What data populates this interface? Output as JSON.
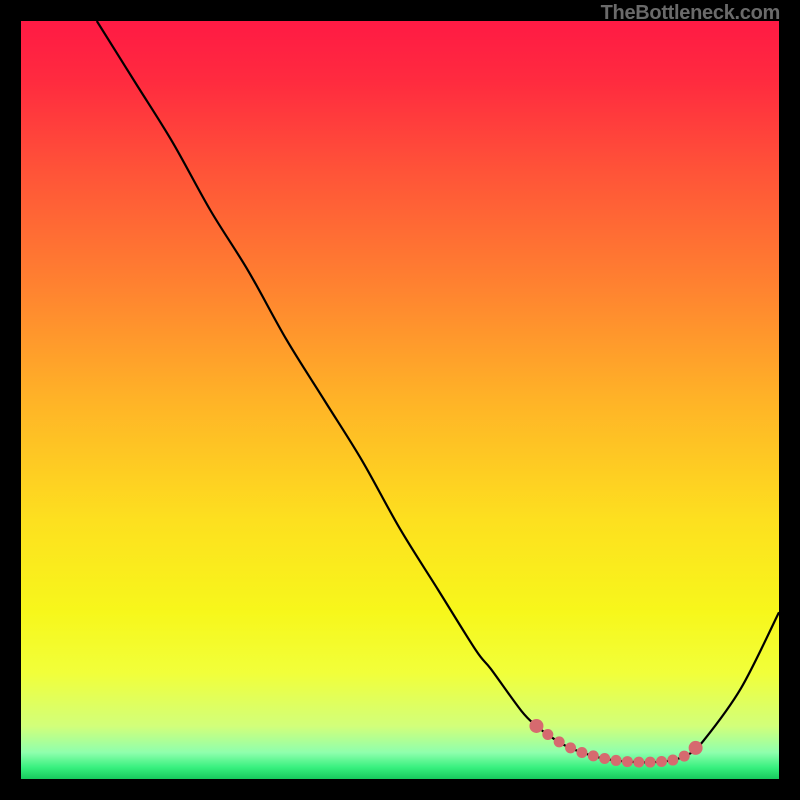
{
  "watermark": "TheBottleneck.com",
  "chart_data": {
    "type": "line",
    "title": "",
    "xlabel": "",
    "ylabel": "",
    "xlim": [
      0,
      100
    ],
    "ylim": [
      0,
      100
    ],
    "x": [
      10,
      15,
      20,
      25,
      30,
      35,
      40,
      45,
      50,
      55,
      60,
      62,
      66,
      68,
      70,
      72,
      74,
      76,
      78,
      80,
      82,
      84,
      86,
      88,
      90,
      95,
      100
    ],
    "y": [
      100,
      92,
      84,
      75,
      67,
      58,
      50,
      42,
      33,
      25,
      17,
      14.5,
      9,
      7,
      5.5,
      4.3,
      3.5,
      2.9,
      2.5,
      2.3,
      2.2,
      2.25,
      2.5,
      3.2,
      5,
      12,
      22
    ],
    "highlight_range_x": [
      68,
      89
    ],
    "gradient_stops": [
      {
        "offset": 0.0,
        "color": "#ff1a44"
      },
      {
        "offset": 0.08,
        "color": "#ff2b3f"
      },
      {
        "offset": 0.2,
        "color": "#ff5438"
      },
      {
        "offset": 0.35,
        "color": "#ff8230"
      },
      {
        "offset": 0.5,
        "color": "#ffb327"
      },
      {
        "offset": 0.66,
        "color": "#fde01f"
      },
      {
        "offset": 0.78,
        "color": "#f7f71b"
      },
      {
        "offset": 0.86,
        "color": "#f1ff3a"
      },
      {
        "offset": 0.93,
        "color": "#d2ff7a"
      },
      {
        "offset": 0.965,
        "color": "#8fffad"
      },
      {
        "offset": 0.985,
        "color": "#37f07e"
      },
      {
        "offset": 1.0,
        "color": "#17c95c"
      }
    ]
  }
}
